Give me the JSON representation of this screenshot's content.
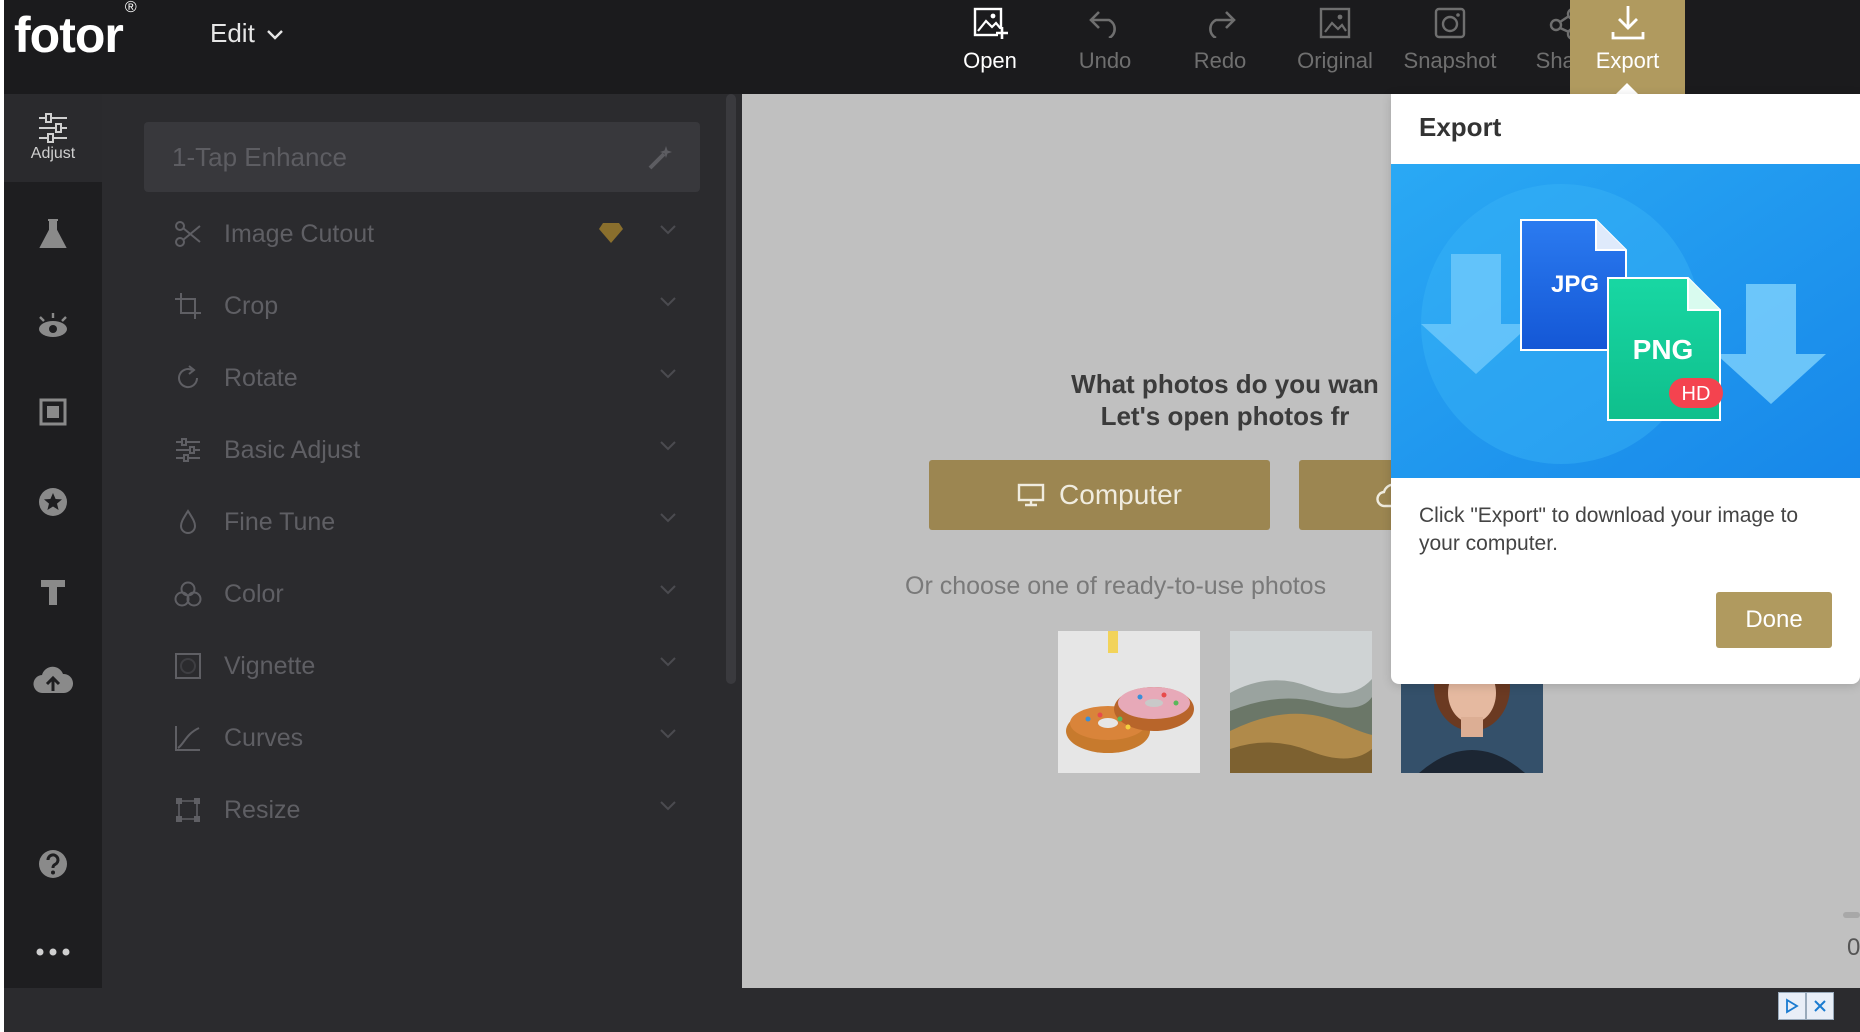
{
  "app": {
    "logo_text": "fotor",
    "logo_mark": "®",
    "edit_menu": "Edit"
  },
  "toolbar": {
    "items": [
      {
        "label": "Open",
        "icon": "image-add-icon"
      },
      {
        "label": "Undo",
        "icon": "undo-icon"
      },
      {
        "label": "Redo",
        "icon": "redo-icon"
      },
      {
        "label": "Original",
        "icon": "image-icon"
      },
      {
        "label": "Snapshot",
        "icon": "camera-icon"
      },
      {
        "label": "Share",
        "icon": "share-icon"
      },
      {
        "label": "Export",
        "icon": "download-icon"
      }
    ]
  },
  "rail": {
    "adjust_label": "Adjust"
  },
  "panel": {
    "enhance_placeholder": "1-Tap Enhance",
    "items": [
      {
        "label": "Image Cutout"
      },
      {
        "label": "Crop"
      },
      {
        "label": "Rotate"
      },
      {
        "label": "Basic Adjust"
      },
      {
        "label": "Fine Tune"
      },
      {
        "label": "Color"
      },
      {
        "label": "Vignette"
      },
      {
        "label": "Curves"
      },
      {
        "label": "Resize"
      }
    ]
  },
  "canvas": {
    "prompt_line1": "What photos do you wan",
    "prompt_line2": "Let's open photos fr",
    "computer_button": "Computer",
    "choose_text": "Or choose one of ready-to-use photos"
  },
  "export_popup": {
    "title": "Export",
    "badge_jpg": "JPG",
    "badge_png": "PNG",
    "badge_hd": "HD",
    "description": "Click \"Export\" to download your image to your computer.",
    "done_button": "Done"
  },
  "right_edge": {
    "text": "0"
  },
  "colors": {
    "topbar": "#1b1b1d",
    "panel": "#2b2b2e",
    "accent_gold": "#b09a5f",
    "canvas": "#c0c0c0"
  }
}
